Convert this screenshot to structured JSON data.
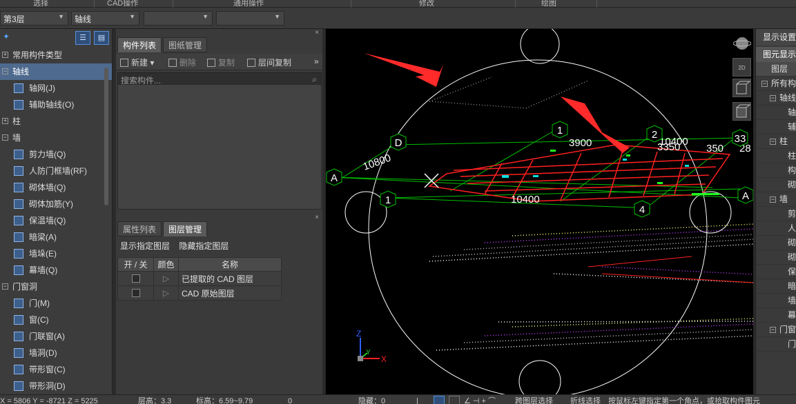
{
  "ribbon": {
    "tabs": [
      "选择",
      "CAD操作",
      "通用操作",
      "修改",
      "绘图"
    ]
  },
  "toolbar": {
    "floor": "第3层",
    "category": "轴线",
    "dropdown3": "",
    "dropdown4": ""
  },
  "left_tree": [
    {
      "type": "cat",
      "label": "常用构件类型",
      "expander": "+"
    },
    {
      "type": "cat",
      "label": "轴线",
      "expander": "−",
      "selected": true
    },
    {
      "type": "child",
      "label": "轴网(J)",
      "icon": "grid-icon"
    },
    {
      "type": "child",
      "label": "辅助轴线(O)",
      "icon": "aux-grid-icon"
    },
    {
      "type": "cat",
      "label": "柱",
      "expander": "+"
    },
    {
      "type": "cat",
      "label": "墙",
      "expander": "−"
    },
    {
      "type": "child",
      "label": "剪力墙(Q)",
      "icon": "shear-wall-icon"
    },
    {
      "type": "child",
      "label": "人防门框墙(RF)",
      "icon": "civil-defense-wall-icon"
    },
    {
      "type": "child",
      "label": "砌体墙(Q)",
      "icon": "masonry-wall-icon"
    },
    {
      "type": "child",
      "label": "砌体加筋(Y)",
      "icon": "masonry-rebar-icon"
    },
    {
      "type": "child",
      "label": "保温墙(Q)",
      "icon": "insulation-wall-icon"
    },
    {
      "type": "child",
      "label": "暗梁(A)",
      "icon": "hidden-beam-icon"
    },
    {
      "type": "child",
      "label": "墙垛(E)",
      "icon": "wall-pier-icon"
    },
    {
      "type": "child",
      "label": "幕墙(Q)",
      "icon": "curtain-wall-icon"
    },
    {
      "type": "cat",
      "label": "门窗洞",
      "expander": "−"
    },
    {
      "type": "child",
      "label": "门(M)",
      "icon": "door-icon"
    },
    {
      "type": "child",
      "label": "窗(C)",
      "icon": "window-icon"
    },
    {
      "type": "child",
      "label": "门联窗(A)",
      "icon": "door-window-icon"
    },
    {
      "type": "child",
      "label": "墙洞(D)",
      "icon": "wall-hole-icon"
    },
    {
      "type": "child",
      "label": "带形窗(C)",
      "icon": "strip-window-icon"
    },
    {
      "type": "child",
      "label": "带形洞(D)",
      "icon": "strip-hole-icon"
    }
  ],
  "component_panel": {
    "tabs": [
      "构件列表",
      "图纸管理"
    ],
    "actions": {
      "new": "新建",
      "delete": "删除",
      "copy": "复制",
      "floor_copy": "层间复制"
    },
    "search_placeholder": "搜索构件..."
  },
  "layer_panel": {
    "tabs": [
      "属性列表",
      "图层管理"
    ],
    "show_label": "显示指定图层",
    "hide_label": "隐藏指定图层",
    "columns": [
      "开 / 关",
      "颜色",
      "名称"
    ],
    "rows": [
      {
        "name": "已提取的 CAD 图层"
      },
      {
        "name": "CAD 原始图层"
      }
    ]
  },
  "viewport": {
    "dimensions": {
      "d1": "10800",
      "d2": "3900",
      "d3": "10400",
      "d4": "3350",
      "d5": "350",
      "d6": "10400",
      "d7": "28"
    },
    "axis_labels": {
      "a": "A",
      "d": "D",
      "n1a": "1",
      "n1b": "1",
      "n2": "2",
      "n4": "4",
      "n3": "33",
      "right_a": "A"
    },
    "axis_tripod": {
      "z": "Z",
      "y": "Y",
      "x": "X"
    },
    "colors": {
      "grid": "#00c000",
      "rebar": "#ff2020",
      "arrow": "#ff2a2a",
      "circle": "#ffffff"
    }
  },
  "view_tools": [
    "sphere",
    "2D",
    "cube-top",
    "cube-iso"
  ],
  "right_panel": {
    "title": "显示设置",
    "tab": "图元显示",
    "header": "图层",
    "rows": [
      {
        "label": "所有构",
        "expander": "−",
        "level": 0
      },
      {
        "label": "轴线",
        "expander": "−",
        "level": 1
      },
      {
        "label": "轴",
        "level": 2
      },
      {
        "label": "辅",
        "level": 2
      },
      {
        "label": "柱",
        "expander": "−",
        "level": 1
      },
      {
        "label": "柱",
        "level": 2
      },
      {
        "label": "构",
        "level": 2
      },
      {
        "label": "砌",
        "level": 2
      },
      {
        "label": "墙",
        "expander": "−",
        "level": 1
      },
      {
        "label": "剪",
        "level": 2
      },
      {
        "label": "人",
        "level": 2
      },
      {
        "label": "砌",
        "level": 2
      },
      {
        "label": "砌",
        "level": 2
      },
      {
        "label": "保",
        "level": 2
      },
      {
        "label": "暗",
        "level": 2
      },
      {
        "label": "墙",
        "level": 2
      },
      {
        "label": "幕",
        "level": 2
      },
      {
        "label": "门窗",
        "expander": "−",
        "level": 1
      },
      {
        "label": "门",
        "level": 2
      }
    ]
  },
  "status": {
    "coords": "X = 5806 Y = -8721 Z = 5225",
    "floor_height": "层高：3.3",
    "elevation": "标高：6.59~9.79",
    "zero": "0",
    "hidden": "隐藏：0",
    "cross_select": "跨图层选择",
    "polyline_select": "折线选择",
    "hint": "按鼠标左键指定第一个角点，或拾取构件图元"
  }
}
